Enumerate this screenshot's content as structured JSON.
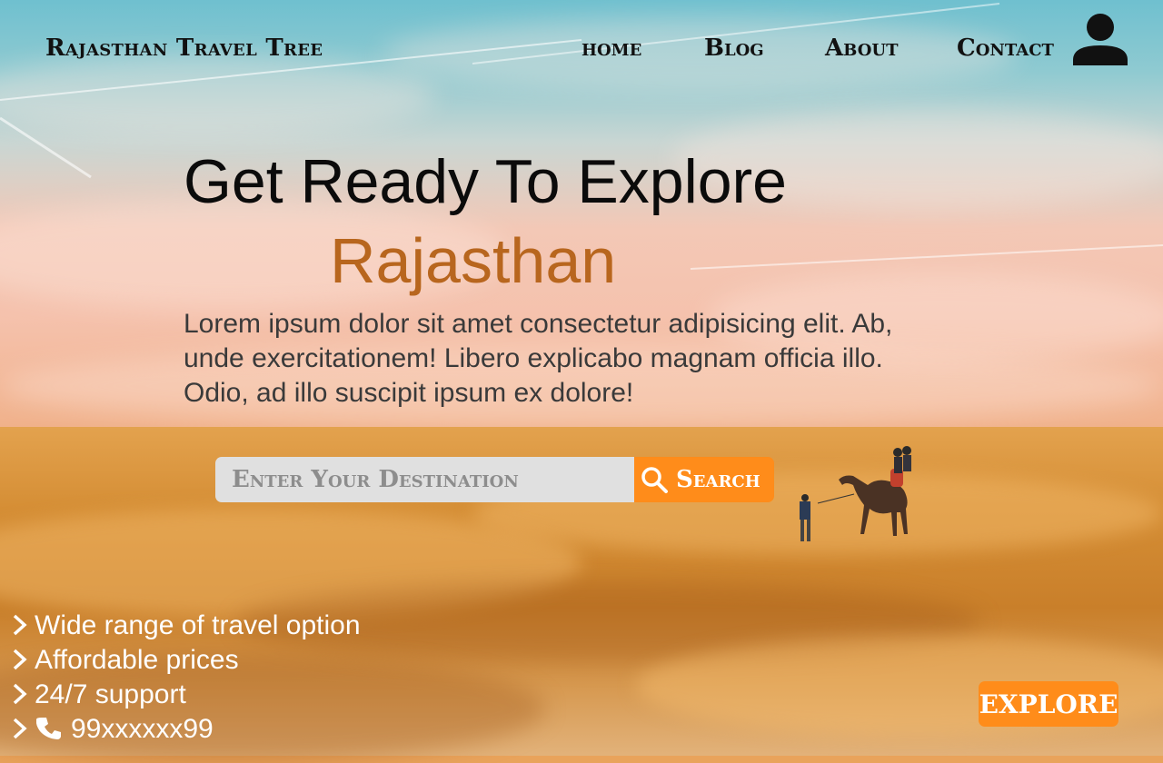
{
  "brand": {
    "name": "Rajasthan Travel Tree"
  },
  "nav": {
    "items": [
      {
        "label": "home"
      },
      {
        "label": "Blog"
      },
      {
        "label": "About"
      },
      {
        "label": "Contact"
      }
    ],
    "user_icon": "user-icon"
  },
  "hero": {
    "headline": "Get Ready To Explore",
    "subheadline": "Rajasthan",
    "description": "Lorem ipsum dolor sit amet consectetur adipisicing elit. Ab, unde exercitationem! Libero explicabo magnam officia illo. Odio, ad illo suscipit ipsum ex dolore!"
  },
  "search": {
    "placeholder": "Enter Your Destination",
    "value": "",
    "button_label": "Search",
    "button_icon": "search-icon"
  },
  "features": [
    {
      "text": "Wide range of travel option",
      "icon": "chevron-right-icon"
    },
    {
      "text": "Affordable prices",
      "icon": "chevron-right-icon"
    },
    {
      "text": "24/7 support",
      "icon": "chevron-right-icon"
    },
    {
      "text": "99xxxxxx99",
      "icon": "phone-icon"
    }
  ],
  "explore": {
    "label": "EXPLORE"
  },
  "colors": {
    "accent": "#ff8c1a",
    "subheadline": "#b8661e",
    "text_dark": "#0b0b0b",
    "text_body": "#3a3a3a"
  }
}
